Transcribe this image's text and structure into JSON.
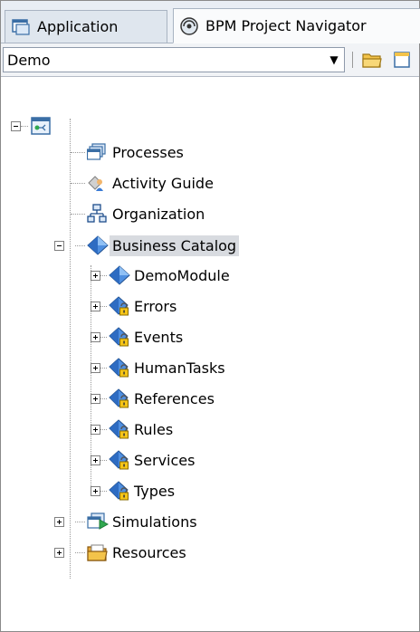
{
  "tabs": [
    {
      "label": "Application",
      "icon": "application-icon",
      "active": false
    },
    {
      "label": "BPM Project Navigator",
      "icon": "bpm-navigator-icon",
      "active": true
    }
  ],
  "toolbar": {
    "project_value": "Demo",
    "icons": [
      "open-folder-icon",
      "new-icon"
    ]
  },
  "tree": {
    "root_icon": "bpm-project-icon",
    "items": [
      {
        "label": "Processes",
        "icon": "processes-icon"
      },
      {
        "label": "Activity Guide",
        "icon": "activity-guide-icon"
      },
      {
        "label": "Organization",
        "icon": "organization-icon"
      },
      {
        "label": "Business Catalog",
        "icon": "business-catalog-icon",
        "selected": true,
        "expanded": true,
        "children": [
          {
            "label": "DemoModule",
            "icon": "module-icon"
          },
          {
            "label": "Errors",
            "icon": "locked-module-icon"
          },
          {
            "label": "Events",
            "icon": "locked-module-icon"
          },
          {
            "label": "HumanTasks",
            "icon": "locked-module-icon"
          },
          {
            "label": "References",
            "icon": "locked-module-icon"
          },
          {
            "label": "Rules",
            "icon": "locked-module-icon"
          },
          {
            "label": "Services",
            "icon": "locked-module-icon"
          },
          {
            "label": "Types",
            "icon": "locked-module-icon"
          }
        ]
      },
      {
        "label": "Simulations",
        "icon": "simulations-icon"
      },
      {
        "label": "Resources",
        "icon": "resources-icon"
      }
    ]
  },
  "colors": {
    "selection": "#d8dbe0",
    "tab_bar": "#e9eef4",
    "diamond_blue": "#3a7bd5",
    "lock_yellow": "#f5c518"
  }
}
